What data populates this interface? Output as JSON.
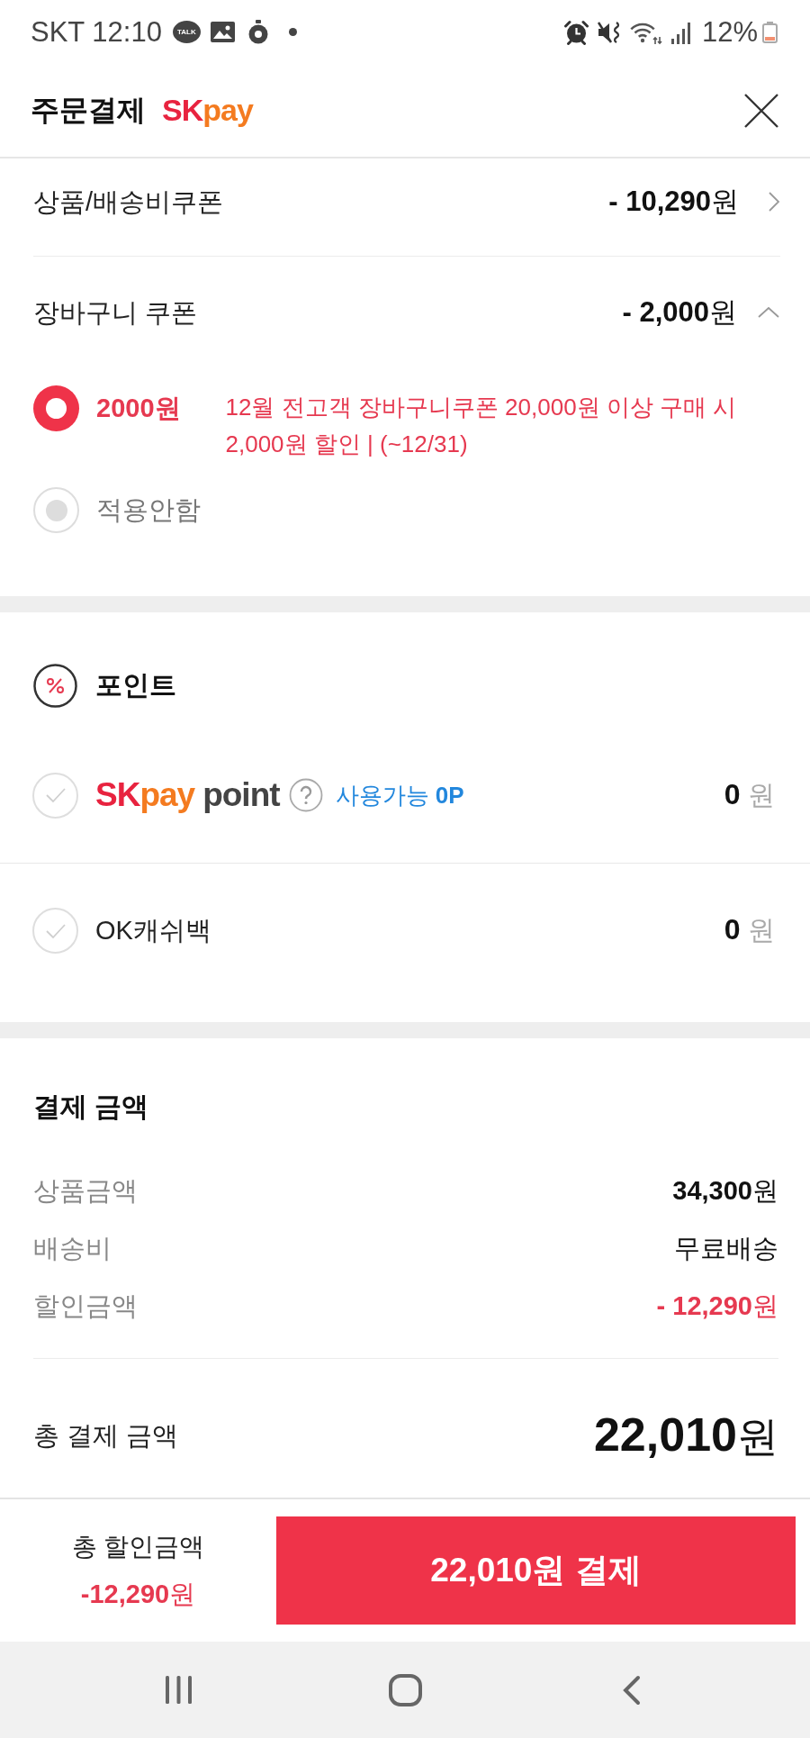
{
  "status_bar": {
    "time": "SKT 12:10",
    "talk_badge": "TALK",
    "battery_text": "12%"
  },
  "header": {
    "title": "주문결제",
    "logo": [
      "SK",
      "pay"
    ]
  },
  "coupons": [
    {
      "kind": "link",
      "label": "상품/배송비쿠폰",
      "amount": "**- 10,290**원"
    },
    {
      "kind": "accordion",
      "label": "장바구니 쿠폰",
      "amount": "**- 2,000**원",
      "expanded": true,
      "options": [
        {
          "label": "2000원",
          "description": "12월 전고객 장바구니쿠폰 20,000원 이상 구매 시 2,000원 할인 | (~12/31)",
          "selected": true
        },
        {
          "label": "적용안함",
          "selected": false
        }
      ]
    }
  ],
  "points": {
    "title": "포인트",
    "items": [
      {
        "kind": "brand",
        "logo": [
          "SK",
          "pay"
        ],
        "logo_suffix": "point",
        "available": "사용가능 **0P**",
        "amount": "**0** 원",
        "checked": false
      },
      {
        "kind": "text",
        "label": "OK캐쉬백",
        "amount": "**0** 원",
        "checked": false
      }
    ]
  },
  "payment": {
    "title": "결제 금액",
    "rows": [
      {
        "kind": "normal",
        "label": "상품금액",
        "value": "**34,300**원"
      },
      {
        "kind": "normal",
        "label": "배송비",
        "value": "무료배송"
      },
      {
        "kind": "discount",
        "label": "할인금액",
        "value": "**- 12,290**원"
      }
    ],
    "total": {
      "label": "총 결제 금액",
      "value": "**22,010**원"
    }
  },
  "bottom_bar": {
    "discount_label": "총 할인금액",
    "discount_value": "**-12,290**원",
    "pay_button": "22,010원 결제"
  }
}
